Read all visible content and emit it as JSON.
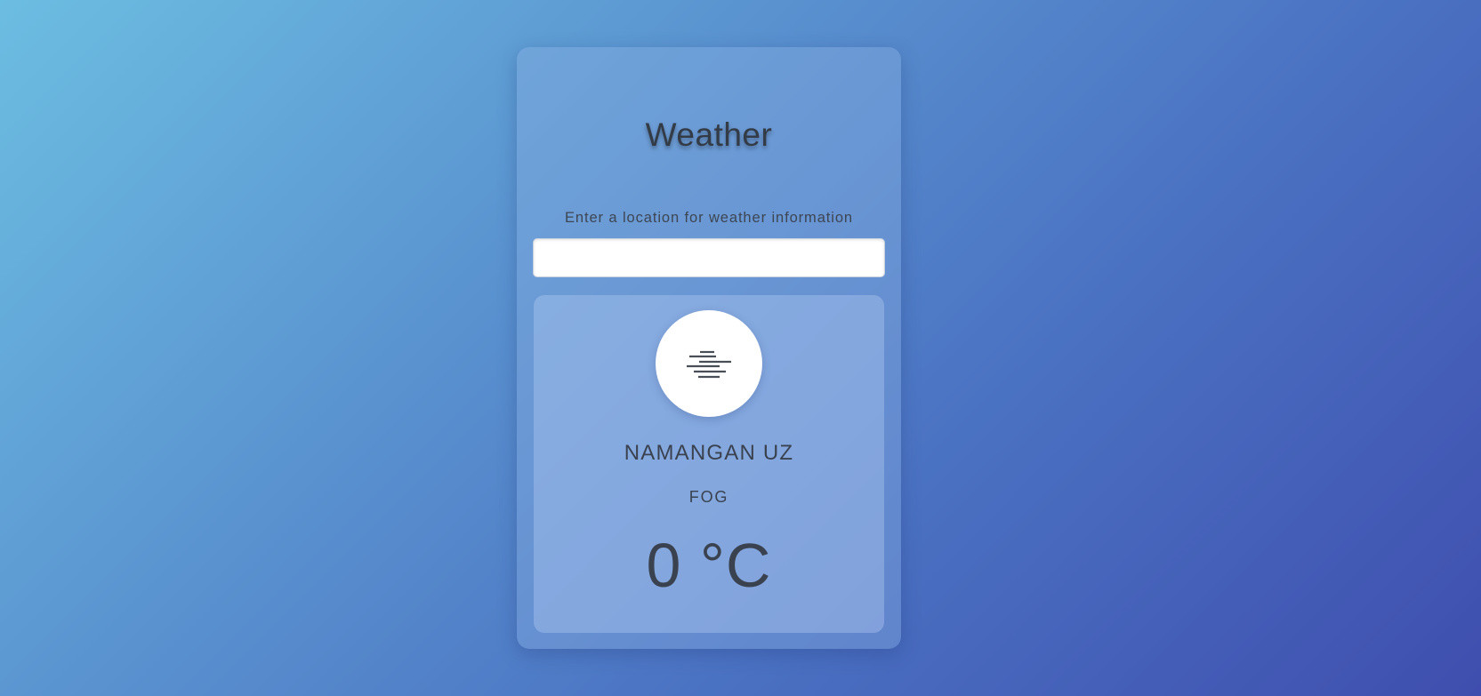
{
  "app": {
    "title": "Weather"
  },
  "search": {
    "label": "Enter a location for weather information",
    "value": "",
    "placeholder": ""
  },
  "result": {
    "icon": "fog-icon",
    "city": "NAMANGAN UZ",
    "condition": "FOG",
    "temperature": "0 °C"
  },
  "colors": {
    "gradient_start": "#6cbde2",
    "gradient_end": "#3f4eae",
    "text": "#3a4250"
  }
}
